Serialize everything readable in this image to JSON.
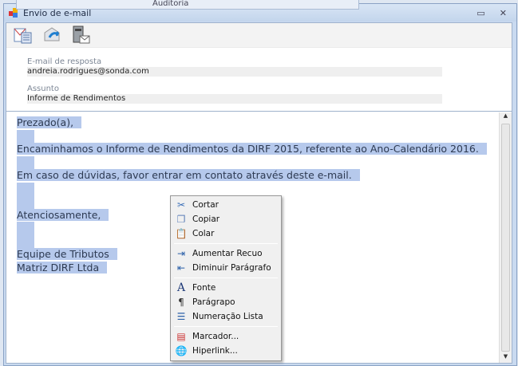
{
  "background": {
    "tab_label": "Auditoria"
  },
  "window": {
    "title": "Envio de e-mail",
    "minimize_label": "▭",
    "close_label": "✕"
  },
  "toolbar": {
    "buttons": [
      "new-message-icon",
      "send-icon",
      "server-mail-icon"
    ]
  },
  "fields": {
    "reply_label": "E-mail de resposta",
    "reply_value": "andreia.rodrigues@sonda.com",
    "subject_label": "Assunto",
    "subject_value": "Informe de Rendimentos"
  },
  "body": {
    "lines": [
      "Prezado(a),",
      "",
      "Encaminhamos o Informe de Rendimentos da DIRF 2015, referente ao  Ano-Calendário 2016.",
      "",
      "Em caso de dúvidas, favor entrar em contato através deste e-mail.",
      "",
      "",
      "Atenciosamente,",
      "",
      "",
      "Equipe de Tributos",
      "Matriz DIRF Ltda"
    ]
  },
  "context_menu": {
    "items": [
      "Cortar",
      "Copiar",
      "Colar",
      "Aumentar Recuo",
      "Diminuir Parágrafo",
      "Fonte",
      "Parágrapo",
      "Numeração Lista",
      "Marcador...",
      "Hiperlink..."
    ]
  },
  "colors": {
    "selection": "#b6c9ec",
    "title_bar": "#c9daf0"
  }
}
